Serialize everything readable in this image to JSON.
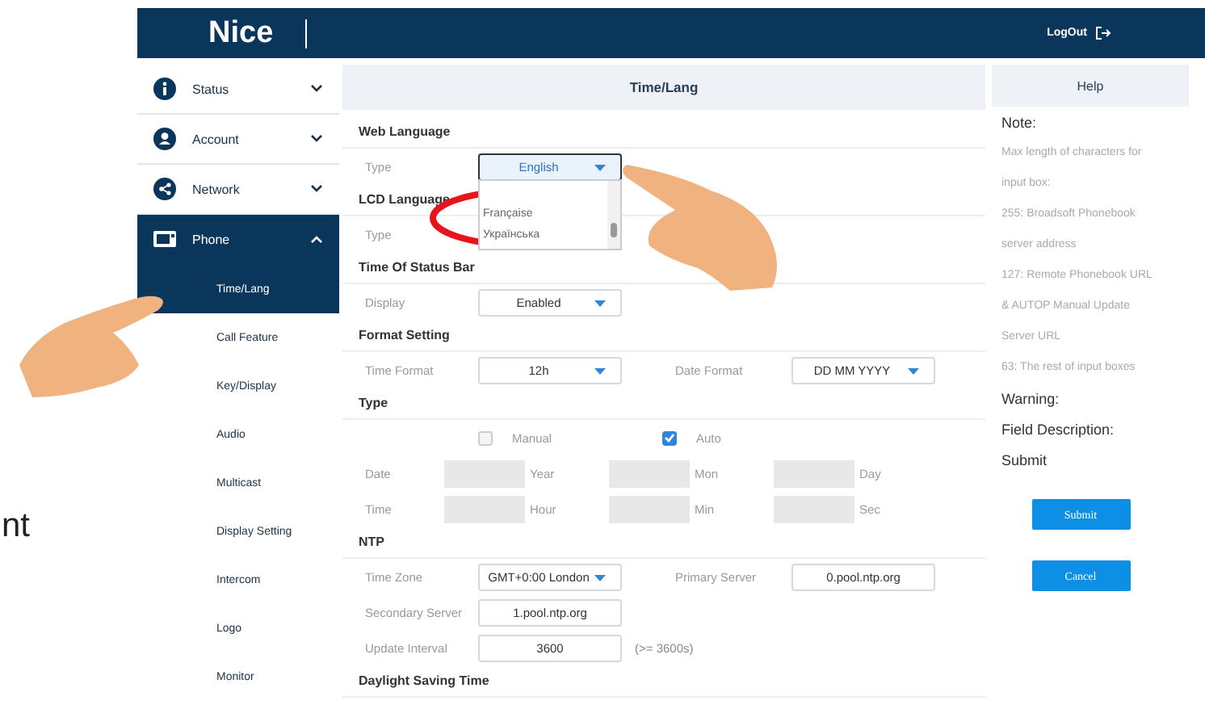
{
  "header": {
    "logo": "Nice",
    "logout": "LogOut"
  },
  "caption_fragment": "nt",
  "sidebar": {
    "items": [
      {
        "label": "Status",
        "expanded": false,
        "selected": false
      },
      {
        "label": "Account",
        "expanded": false,
        "selected": false
      },
      {
        "label": "Network",
        "expanded": false,
        "selected": false
      },
      {
        "label": "Phone",
        "expanded": true,
        "selected": true,
        "children": [
          {
            "label": "Time/Lang",
            "selected": true
          },
          {
            "label": "Call Feature",
            "selected": false
          },
          {
            "label": "Key/Display",
            "selected": false
          },
          {
            "label": "Audio",
            "selected": false
          },
          {
            "label": "Multicast",
            "selected": false
          },
          {
            "label": "Display Setting",
            "selected": false
          },
          {
            "label": "Intercom",
            "selected": false
          },
          {
            "label": "Logo",
            "selected": false
          },
          {
            "label": "Monitor",
            "selected": false
          }
        ]
      }
    ]
  },
  "main": {
    "title": "Time/Lang",
    "sections": [
      {
        "heading": "Web Language",
        "rows": [
          {
            "kind": "select",
            "label": "Type",
            "value": "English",
            "open": true,
            "options": [
              "Française",
              "Українська"
            ]
          }
        ]
      },
      {
        "heading": "LCD Language",
        "rows": [
          {
            "kind": "label",
            "label": "Type"
          }
        ]
      },
      {
        "heading": "Time Of Status Bar",
        "rows": [
          {
            "kind": "select",
            "label": "Display",
            "value": "Enabled",
            "open": false
          }
        ]
      },
      {
        "heading": "Format Setting",
        "rows": [
          {
            "kind": "select",
            "label": "Time Format",
            "value": "12h",
            "open": false,
            "second": {
              "label": "Date Format",
              "value": "DD MM YYYY"
            }
          }
        ]
      },
      {
        "heading": "Type",
        "rows": [
          {
            "kind": "options",
            "options": [
              {
                "label": "Manual",
                "checked": false
              },
              {
                "label": "Auto",
                "checked": true
              }
            ]
          },
          {
            "kind": "triple",
            "label": "Date",
            "units": [
              "Year",
              "Mon",
              "Day"
            ]
          },
          {
            "kind": "triple",
            "label": "Time",
            "units": [
              "Hour",
              "Min",
              "Sec"
            ]
          }
        ]
      },
      {
        "heading": "NTP",
        "rows": [
          {
            "kind": "select",
            "label": "Time Zone",
            "value": "GMT+0:00 London",
            "open": false,
            "second": {
              "label": "Primary Server",
              "value": "0.pool.ntp.org"
            }
          },
          {
            "kind": "input",
            "label": "Secondary Server",
            "value": "1.pool.ntp.org"
          },
          {
            "kind": "input",
            "label": "Update Interval",
            "value": "3600",
            "suffix": "(>= 3600s)"
          }
        ]
      },
      {
        "heading": "Daylight Saving Time"
      }
    ]
  },
  "help": {
    "title": "Help",
    "lines": [
      {
        "kind": "heading",
        "text": "Note:"
      },
      {
        "kind": "note",
        "text": "Max length of characters for"
      },
      {
        "kind": "note",
        "text": "input box:"
      },
      {
        "kind": "note",
        "text": "255: Broadsoft Phonebook"
      },
      {
        "kind": "note",
        "text": "server address"
      },
      {
        "kind": "note",
        "text": "127: Remote Phonebook URL"
      },
      {
        "kind": "note",
        "text": "& AUTOP Manual Update"
      },
      {
        "kind": "note",
        "text": "Server URL"
      },
      {
        "kind": "note",
        "text": "63: The rest of input boxes"
      },
      {
        "kind": "heading",
        "text": "Warning:"
      },
      {
        "kind": "heading",
        "text": "Field Description:"
      },
      {
        "kind": "heading",
        "text": "Submit"
      }
    ],
    "buttons": [
      "Submit",
      "Cancel"
    ]
  }
}
